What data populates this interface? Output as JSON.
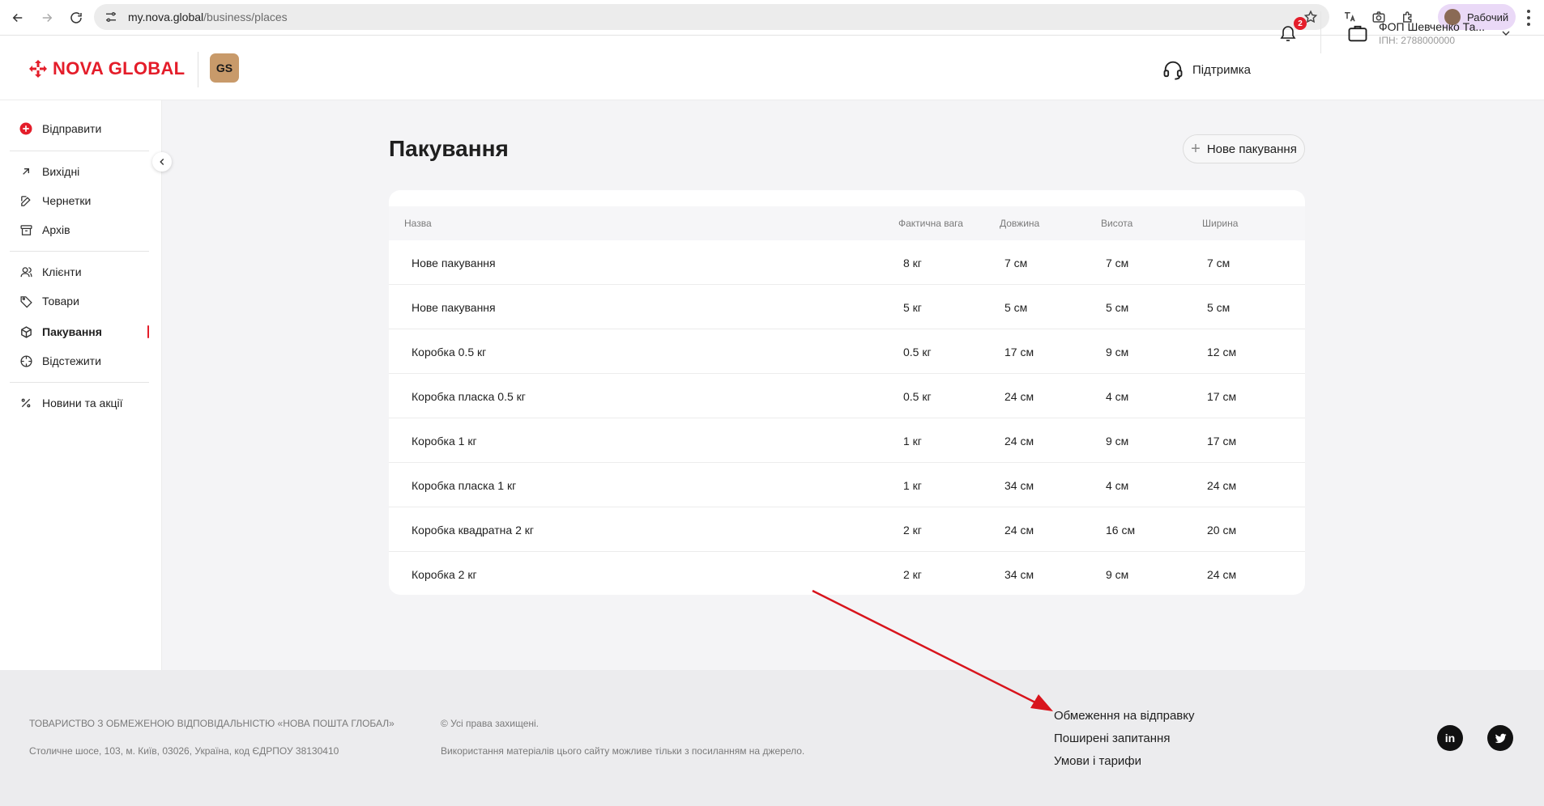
{
  "browser": {
    "url_host": "my.nova.global",
    "url_path": "/business/places",
    "profile_label": "Рабочий"
  },
  "header": {
    "logo_text": "NOVA GLOBAL",
    "badge": "GS",
    "support_label": "Підтримка",
    "notifications_count": "2",
    "account_name": "ФОП Шевченко Та...",
    "account_ipn": "ІПН: 2788000000"
  },
  "sidebar": {
    "items": [
      {
        "label": "Відправити"
      },
      {
        "label": "Вихідні"
      },
      {
        "label": "Чернетки"
      },
      {
        "label": "Архів"
      },
      {
        "label": "Клієнти"
      },
      {
        "label": "Товари"
      },
      {
        "label": "Пакування"
      },
      {
        "label": "Відстежити"
      },
      {
        "label": "Новини та акції"
      }
    ]
  },
  "main": {
    "title": "Пакування",
    "new_button": "Нове пакування",
    "columns": [
      "Назва",
      "Фактична вага",
      "Довжина",
      "Висота",
      "Ширина"
    ],
    "rows": [
      [
        "Нове пакування",
        "8 кг",
        "7 см",
        "7 см",
        "7 см"
      ],
      [
        "Нове пакування",
        "5 кг",
        "5 см",
        "5 см",
        "5 см"
      ],
      [
        "Коробка 0.5 кг",
        "0.5 кг",
        "17 см",
        "9 см",
        "12 см"
      ],
      [
        "Коробка пласка 0.5 кг",
        "0.5 кг",
        "24 см",
        "4 см",
        "17 см"
      ],
      [
        "Коробка 1 кг",
        "1 кг",
        "24 см",
        "9 см",
        "17 см"
      ],
      [
        "Коробка пласка 1 кг",
        "1 кг",
        "34 см",
        "4 см",
        "24 см"
      ],
      [
        "Коробка квадратна 2 кг",
        "2 кг",
        "24 см",
        "16 см",
        "20 см"
      ],
      [
        "Коробка 2 кг",
        "2 кг",
        "34 см",
        "9 см",
        "24 см"
      ]
    ]
  },
  "footer": {
    "company": "ТОВАРИСТВО З ОБМЕЖЕНОЮ ВІДПОВІДАЛЬНІСТЮ «НОВА ПОШТА ГЛОБАЛ»",
    "address": "Столичне шосе, 103, м. Київ, 03026, Україна, код ЄДРПОУ 38130410",
    "rights": "© Усі права захищені.",
    "usage": "Використання матеріалів цього сайту можливе тільки з посиланням на джерело.",
    "links": [
      "Обмеження на відправку",
      "Поширені запитання",
      "Умови і тарифи"
    ],
    "social": [
      "in",
      "twitter"
    ]
  },
  "colors": {
    "brand_red": "#e41d2a",
    "annotation_arrow": "#d8141c"
  }
}
